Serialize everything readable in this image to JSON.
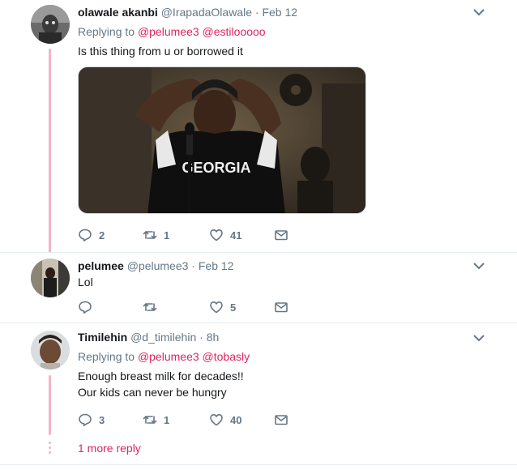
{
  "tweets": [
    {
      "name": "olawale akanbi",
      "handle": "@IrapadaOlawale",
      "dot": "·",
      "time": "Feb 12",
      "replying_prefix": "Replying to ",
      "mentions": [
        "@pelumee3",
        "@estilooooo"
      ],
      "text": "Is this thing from u or borrowed it",
      "photo_text": "GEORGIA",
      "actions": {
        "reply": "2",
        "retweet": "1",
        "like": "41",
        "message": ""
      }
    },
    {
      "name": "pelumee",
      "handle": "@pelumee3",
      "dot": "·",
      "time": "Feb 12",
      "text": "Lol",
      "actions": {
        "reply": "",
        "retweet": "",
        "like": "5",
        "message": ""
      }
    },
    {
      "name": "Timilehin",
      "handle": "@d_timilehin",
      "dot": "·",
      "time": "8h",
      "replying_prefix": "Replying to ",
      "mentions": [
        "@pelumee3",
        "@tobasly"
      ],
      "text_lines": [
        "Enough breast milk for decades!!",
        "Our kids can never be hungry"
      ],
      "actions": {
        "reply": "3",
        "retweet": "1",
        "like": "40",
        "message": ""
      }
    }
  ],
  "more_reply": "1 more reply",
  "colors": {
    "accent": "#e0245e",
    "thread": "#f3b4c3",
    "muted": "#657786",
    "divider": "#e6ecf0"
  }
}
